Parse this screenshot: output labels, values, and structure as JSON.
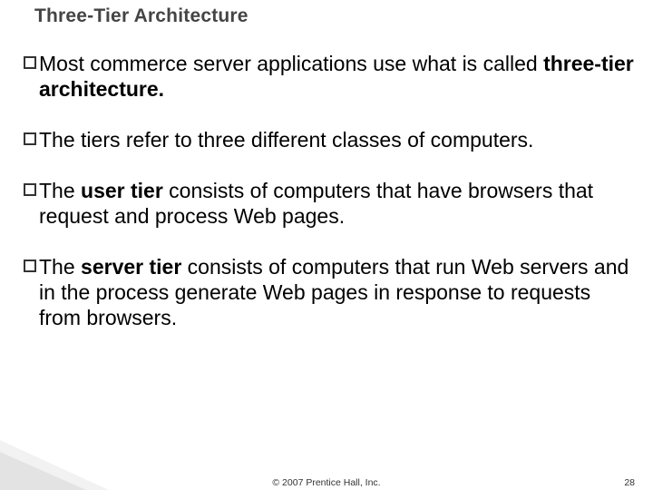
{
  "title": "Three-Tier Architecture",
  "bullets": [
    {
      "segments": [
        {
          "t": "Most commerce server applications use what is called ",
          "b": false
        },
        {
          "t": "three-tier architecture.",
          "b": true
        }
      ]
    },
    {
      "segments": [
        {
          "t": "The tiers refer to three different classes of computers.",
          "b": false
        }
      ]
    },
    {
      "segments": [
        {
          "t": "The ",
          "b": false
        },
        {
          "t": "user tier",
          "b": true
        },
        {
          "t": " consists of computers that have browsers that request and process Web pages.",
          "b": false
        }
      ]
    },
    {
      "segments": [
        {
          "t": "The ",
          "b": false
        },
        {
          "t": "server tier",
          "b": true
        },
        {
          "t": " consists of computers that run Web servers and in the process generate Web pages in response to requests from browsers.",
          "b": false
        }
      ]
    }
  ],
  "footer": {
    "copyright": "© 2007 Prentice Hall, Inc.",
    "page": "28"
  }
}
